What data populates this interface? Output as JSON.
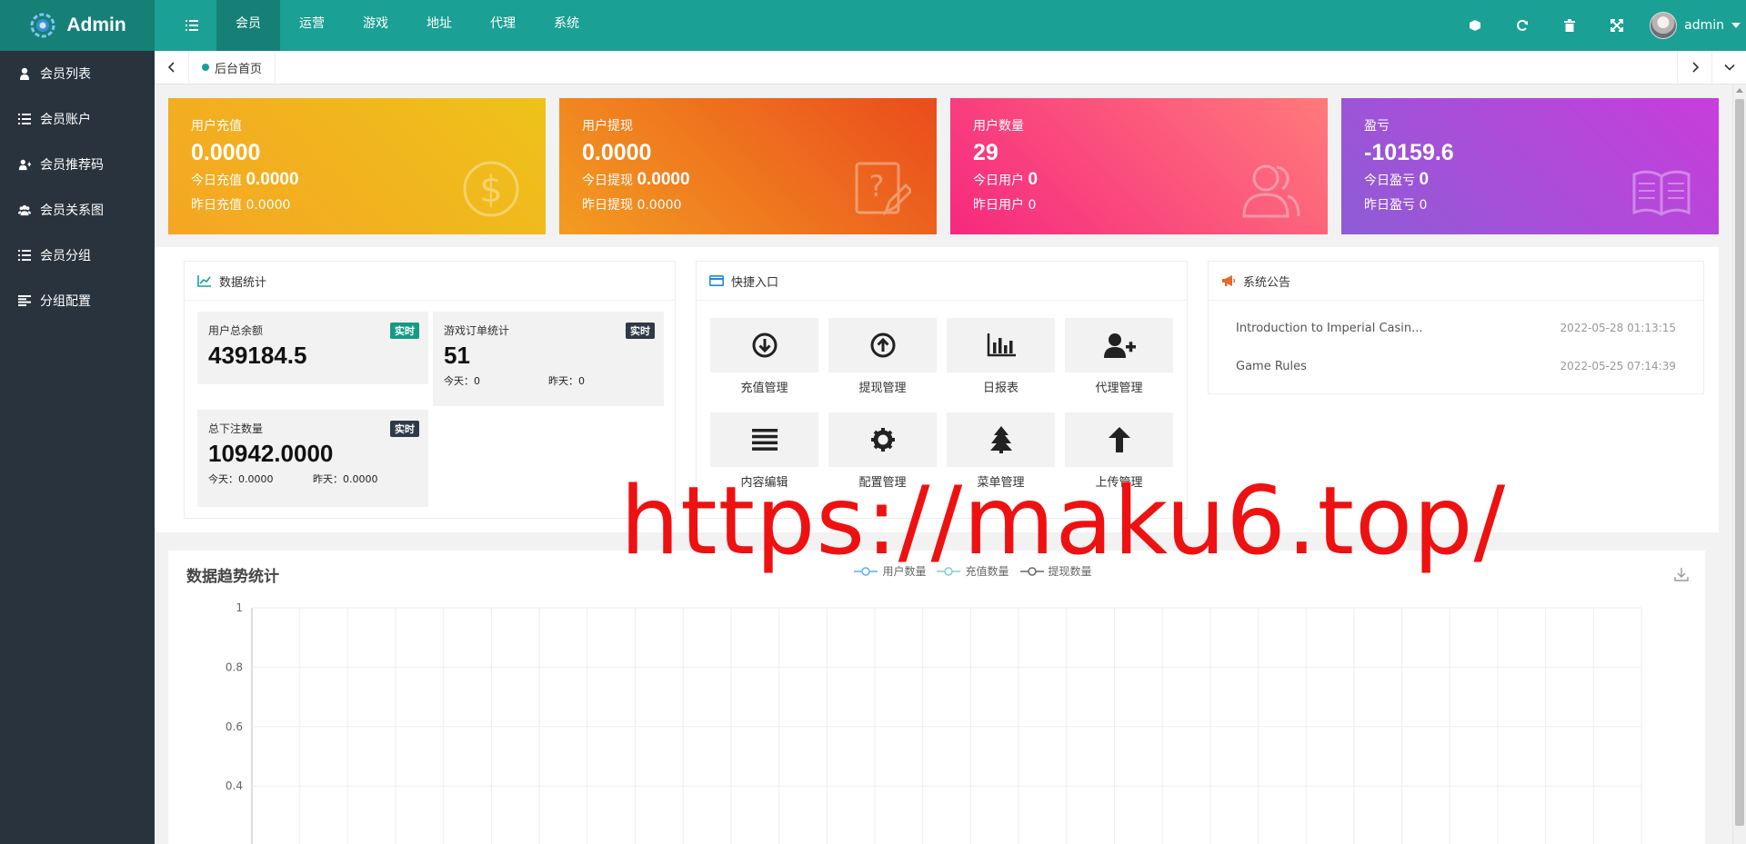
{
  "header": {
    "logo_text": "Admin",
    "nav": [
      "会员",
      "运营",
      "游戏",
      "地址",
      "代理",
      "系统"
    ],
    "active_nav": 0,
    "user_name": "admin",
    "tools": [
      "clear-cache-icon",
      "refresh-icon",
      "trash-icon",
      "fullscreen-icon"
    ]
  },
  "sidebar": {
    "items": [
      {
        "label": "会员列表",
        "icon": "user-icon"
      },
      {
        "label": "会员账户",
        "icon": "list-icon"
      },
      {
        "label": "会员推荐码",
        "icon": "user-plus-icon"
      },
      {
        "label": "会员关系图",
        "icon": "users-icon"
      },
      {
        "label": "会员分组",
        "icon": "list-icon"
      },
      {
        "label": "分组配置",
        "icon": "align-left-icon"
      }
    ]
  },
  "tabs": {
    "home_label": "后台首页"
  },
  "cards": [
    {
      "title": "用户充值",
      "value": "0.0000",
      "today_label": "今日充值",
      "today_value": "0.0000",
      "yesterday_label": "昨日充值",
      "yesterday_value": "0.0000",
      "icon": "dollar-icon",
      "color_from": "#f5a623",
      "color_to": "#eec21a"
    },
    {
      "title": "用户提现",
      "value": "0.0000",
      "today_label": "今日提现",
      "today_value": "0.0000",
      "yesterday_label": "昨日提现",
      "yesterday_value": "0.0000",
      "icon": "question-edit-icon",
      "color_from": "#f39c21",
      "color_to": "#ea4c1c"
    },
    {
      "title": "用户数量",
      "value": "29",
      "today_label": "今日用户",
      "today_value": "0",
      "yesterday_label": "昨日用户",
      "yesterday_value": "0",
      "icon": "users-icon",
      "color_from": "#f6287f",
      "color_to": "#ff7a7a"
    },
    {
      "title": "盈亏",
      "value": "-10159.6",
      "today_label": "今日盈亏",
      "today_value": "0",
      "yesterday_label": "昨日盈亏",
      "yesterday_value": "0",
      "icon": "book-icon",
      "color_from": "#8e5cd6",
      "color_to": "#c83ddb"
    }
  ],
  "data_stats": {
    "title": "数据统计",
    "boxes": [
      {
        "label": "用户总余额",
        "badge": "实时",
        "badge_color": "#169a83",
        "value": "439184.5",
        "sub": []
      },
      {
        "label": "游戏订单统计",
        "badge": "实时",
        "badge_color": "#2f3a46",
        "value": "51",
        "sub": [
          "今天：0",
          "昨天：0"
        ]
      },
      {
        "label": "总下注数量",
        "badge": "实时",
        "badge_color": "#2f3a46",
        "value": "10942.0000",
        "sub": [
          "今天：0.0000",
          "昨天：0.0000"
        ]
      }
    ]
  },
  "quick": {
    "title": "快捷入口",
    "items": [
      {
        "label": "充值管理",
        "icon": "arrow-down-circle-icon"
      },
      {
        "label": "提现管理",
        "icon": "arrow-up-circle-icon"
      },
      {
        "label": "日报表",
        "icon": "bar-chart-icon"
      },
      {
        "label": "代理管理",
        "icon": "user-plus-icon"
      },
      {
        "label": "内容编辑",
        "icon": "align-justify-icon"
      },
      {
        "label": "配置管理",
        "icon": "gear-icon"
      },
      {
        "label": "菜单管理",
        "icon": "tree-icon"
      },
      {
        "label": "上传管理",
        "icon": "upload-icon"
      }
    ]
  },
  "notice": {
    "title": "系统公告",
    "items": [
      {
        "title": "Introduction to Imperial Casin...",
        "date": "2022-05-28 01:13:15"
      },
      {
        "title": "Game Rules",
        "date": "2022-05-25 07:14:39"
      }
    ]
  },
  "chart_data": {
    "type": "line",
    "title": "数据趋势统计",
    "series": [
      {
        "name": "用户数量",
        "color": "#5ab1ef",
        "values": []
      },
      {
        "name": "充值数量",
        "color": "#7fd0d0",
        "values": []
      },
      {
        "name": "提现数量",
        "color": "#666666",
        "values": []
      }
    ],
    "yticks": [
      "1",
      "0.8",
      "0.6",
      "0.4"
    ],
    "ylim": [
      0,
      1
    ],
    "grid": true,
    "legend_position": "top-center"
  },
  "watermark": "https://maku6.top/"
}
